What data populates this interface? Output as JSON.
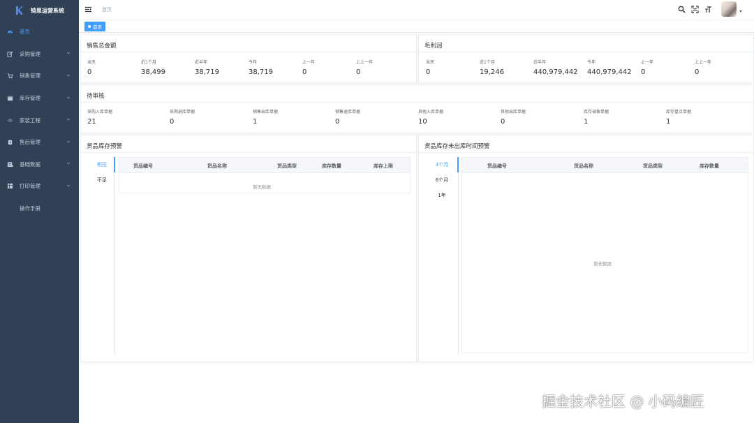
{
  "app": {
    "title": "铠思运营系统",
    "brand_color": "#409eff",
    "sidebar_bg": "#304156"
  },
  "sidebar": {
    "items": [
      {
        "label": "首页",
        "icon": "dashboard-icon",
        "active": true
      },
      {
        "label": "采购管理",
        "icon": "edit-icon"
      },
      {
        "label": "销售管理",
        "icon": "cart-icon"
      },
      {
        "label": "库存管理",
        "icon": "calendar-icon"
      },
      {
        "label": "家装工程",
        "icon": "eye-icon"
      },
      {
        "label": "售后管理",
        "icon": "lock-icon"
      },
      {
        "label": "基础数据",
        "icon": "table-icon"
      },
      {
        "label": "打印管理",
        "icon": "grid-icon"
      },
      {
        "label": "操作手册",
        "icon": ""
      }
    ]
  },
  "header": {
    "breadcrumb": "首页",
    "icons": [
      "search-icon",
      "fullscreen-icon",
      "text-size-icon"
    ]
  },
  "tags": {
    "active_tag": "首页"
  },
  "sales_total": {
    "title": "销售总金额",
    "stats": [
      {
        "label": "当天",
        "value": "0"
      },
      {
        "label": "近1个月",
        "value": "38,499"
      },
      {
        "label": "近半年",
        "value": "38,719"
      },
      {
        "label": "今年",
        "value": "38,719"
      },
      {
        "label": "上一年",
        "value": "0"
      },
      {
        "label": "上上一年",
        "value": "0"
      }
    ]
  },
  "gross_profit": {
    "title": "毛利润",
    "stats": [
      {
        "label": "当天",
        "value": "0"
      },
      {
        "label": "近1个月",
        "value": "19,246"
      },
      {
        "label": "近半年",
        "value": "440,979,442"
      },
      {
        "label": "今年",
        "value": "440,979,442"
      },
      {
        "label": "上一年",
        "value": "0"
      },
      {
        "label": "上上一年",
        "value": "0"
      }
    ]
  },
  "pending": {
    "title": "待审核",
    "stats": [
      {
        "label": "采购入库单据",
        "value": "21"
      },
      {
        "label": "采购退库单据",
        "value": "0"
      },
      {
        "label": "销售出库单据",
        "value": "1"
      },
      {
        "label": "销售退库单据",
        "value": "0"
      },
      {
        "label": "其他入库单据",
        "value": "10"
      },
      {
        "label": "其他出库单据",
        "value": "0"
      },
      {
        "label": "库存调拨单据",
        "value": "1"
      },
      {
        "label": "库存盘点单据",
        "value": "1"
      }
    ]
  },
  "stock_alert": {
    "title": "货品库存预警",
    "tabs": [
      "积压",
      "不足"
    ],
    "active_tab": 0,
    "columns": [
      "货品编号",
      "货品名称",
      "货品类型",
      "库存数量",
      "库存上限"
    ],
    "empty_text": "暂无数据"
  },
  "stale_alert": {
    "title": "货品库存未出库时间预警",
    "tabs": [
      "3个月",
      "6个月",
      "1年"
    ],
    "active_tab": 0,
    "columns": [
      "货品编号",
      "货品名称",
      "货品类型",
      "库存数量"
    ],
    "empty_text": "暂无数据"
  },
  "watermark": "掘金技术社区 @ 小码编匠"
}
